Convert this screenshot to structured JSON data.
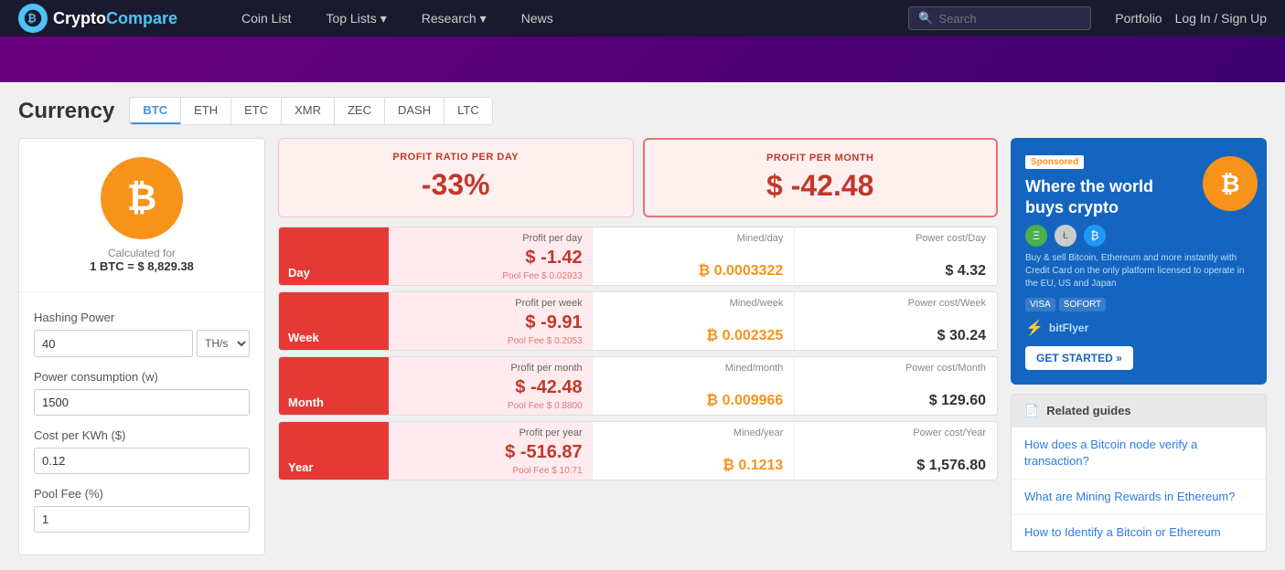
{
  "navbar": {
    "brand": "CryptoCompare",
    "brand_crypto": "Crypto",
    "brand_compare": "Compare",
    "links": [
      {
        "label": "Coin List",
        "id": "coin-list"
      },
      {
        "label": "Top Lists",
        "id": "top-lists",
        "has_dropdown": true
      },
      {
        "label": "Research",
        "id": "research",
        "has_dropdown": true
      },
      {
        "label": "News",
        "id": "news"
      }
    ],
    "search_placeholder": "Search",
    "portfolio_label": "Portfolio",
    "login_label": "Log In / Sign Up"
  },
  "page": {
    "title": "Currency",
    "tabs": [
      {
        "label": "BTC",
        "active": true
      },
      {
        "label": "ETH"
      },
      {
        "label": "ETC"
      },
      {
        "label": "XMR"
      },
      {
        "label": "ZEC"
      },
      {
        "label": "DASH"
      },
      {
        "label": "LTC"
      }
    ]
  },
  "coin": {
    "symbol": "₿",
    "calc_for": "Calculated for",
    "calc_value": "1 BTC = $ 8,829.38"
  },
  "inputs": {
    "hashing_power_label": "Hashing Power",
    "hashing_power_value": "40",
    "hashing_unit": "TH/s",
    "power_consumption_label": "Power consumption (w)",
    "power_value": "1500",
    "cost_per_kwh_label": "Cost per KWh ($)",
    "cost_value": "0.12",
    "pool_fee_label": "Pool Fee (%)",
    "pool_fee_value": "1"
  },
  "summary": {
    "profit_ratio_label": "PROFIT RATIO PER DAY",
    "profit_ratio_value": "-33%",
    "profit_month_label": "PROFIT PER MONTH",
    "profit_month_value": "$ -42.48"
  },
  "rows": [
    {
      "period": "Day",
      "profit_label": "Profit per day",
      "profit_value": "$ -1.42",
      "pool_fee": "Pool Fee $ 0.02933",
      "mined_label": "Mined/day",
      "mined_value": "₿ 0.0003322",
      "power_label": "Power cost/Day",
      "power_value": "$ 4.32"
    },
    {
      "period": "Week",
      "profit_label": "Profit per week",
      "profit_value": "$ -9.91",
      "pool_fee": "Pool Fee $ 0.2053",
      "mined_label": "Mined/week",
      "mined_value": "₿ 0.002325",
      "power_label": "Power cost/Week",
      "power_value": "$ 30.24"
    },
    {
      "period": "Month",
      "profit_label": "Profit per month",
      "profit_value": "$ -42.48",
      "pool_fee": "Pool Fee $ 0.8800",
      "mined_label": "Mined/month",
      "mined_value": "₿ 0.009966",
      "power_label": "Power cost/Month",
      "power_value": "$ 129.60"
    },
    {
      "period": "Year",
      "profit_label": "Profit per year",
      "profit_value": "$ -516.87",
      "pool_fee": "Pool Fee $ 10.71",
      "mined_label": "Mined/year",
      "mined_value": "₿ 0.1213",
      "power_label": "Power cost/Year",
      "power_value": "$ 1,576.80"
    }
  ],
  "ad": {
    "sponsored": "Sponsored",
    "headline": "Where the world buys crypto",
    "subtext": "Buy & sell Bitcoin, Ethereum and more instantly with Credit Card on the only platform licensed to operate in the EU, US and Japan",
    "logos": [
      "VISA",
      "SOFORT"
    ],
    "cta": "GET STARTED »",
    "brand": "bitFlyer"
  },
  "guides": {
    "header": "Related guides",
    "items": [
      "How does a Bitcoin node verify a transaction?",
      "What are Mining Rewards in Ethereum?",
      "How to Identify a Bitcoin or Ethereum"
    ]
  }
}
